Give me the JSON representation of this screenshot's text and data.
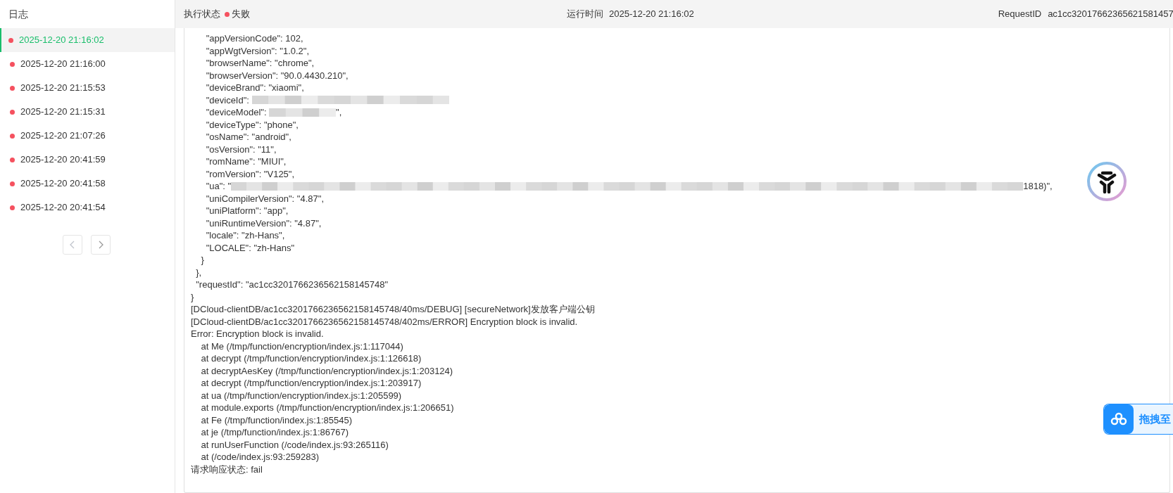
{
  "sidebar": {
    "title": "日志",
    "items": [
      {
        "time": "2025-12-20 21:16:02",
        "selected": true,
        "color": "#f5515f"
      },
      {
        "time": "2025-12-20 21:16:00",
        "selected": false,
        "color": "#f5515f"
      },
      {
        "time": "2025-12-20 21:15:53",
        "selected": false,
        "color": "#f5515f"
      },
      {
        "time": "2025-12-20 21:15:31",
        "selected": false,
        "color": "#f5515f"
      },
      {
        "time": "2025-12-20 21:07:26",
        "selected": false,
        "color": "#f5515f"
      },
      {
        "time": "2025-12-20 20:41:59",
        "selected": false,
        "color": "#f5515f"
      },
      {
        "time": "2025-12-20 20:41:58",
        "selected": false,
        "color": "#f5515f"
      },
      {
        "time": "2025-12-20 20:41:54",
        "selected": false,
        "color": "#f5515f"
      }
    ]
  },
  "header": {
    "status_label": "执行状态",
    "status": {
      "text": "失败",
      "color": "#f5515f"
    },
    "runtime_label": "运行时间",
    "runtime": "2025-12-20 21:16:02",
    "request_label": "RequestID",
    "request_id": "ac1cc32017662365621581457"
  },
  "log_lines": [
    {
      "kind": "text",
      "text": "      \"appVersionCode\": 102,"
    },
    {
      "kind": "text",
      "text": "      \"appWgtVersion\": \"1.0.2\","
    },
    {
      "kind": "text",
      "text": "      \"browserName\": \"chrome\","
    },
    {
      "kind": "text",
      "text": "      \"browserVersion\": \"90.0.4430.210\","
    },
    {
      "kind": "text",
      "text": "      \"deviceBrand\": \"xiaomi\","
    },
    {
      "kind": "redacted",
      "before": "      \"deviceId\": "
    },
    {
      "kind": "redacted",
      "before": "      \"deviceModel\": ",
      "after": "\","
    },
    {
      "kind": "text",
      "text": "      \"deviceType\": \"phone\","
    },
    {
      "kind": "text",
      "text": "      \"osName\": \"android\","
    },
    {
      "kind": "text",
      "text": "      \"osVersion\": \"11\","
    },
    {
      "kind": "text",
      "text": "      \"romName\": \"MIUI\","
    },
    {
      "kind": "text",
      "text": "      \"romVersion\": \"V125\","
    },
    {
      "kind": "redacted",
      "before": "      \"ua\": \"",
      "after": "1818)\","
    },
    {
      "kind": "text",
      "text": "      \"uniCompilerVersion\": \"4.87\","
    },
    {
      "kind": "text",
      "text": "      \"uniPlatform\": \"app\","
    },
    {
      "kind": "text",
      "text": "      \"uniRuntimeVersion\": \"4.87\","
    },
    {
      "kind": "text",
      "text": "      \"locale\": \"zh-Hans\","
    },
    {
      "kind": "text",
      "text": "      \"LOCALE\": \"zh-Hans\""
    },
    {
      "kind": "text",
      "text": "    }"
    },
    {
      "kind": "text",
      "text": "  },"
    },
    {
      "kind": "text",
      "text": "  \"requestId\": \"ac1cc3201766236562158145748\""
    },
    {
      "kind": "text",
      "text": "}"
    },
    {
      "kind": "text",
      "text": "[DCloud-clientDB/ac1cc3201766236562158145748/40ms/DEBUG] [secureNetwork]发放客户端公钥"
    },
    {
      "kind": "text",
      "text": "[DCloud-clientDB/ac1cc3201766236562158145748/402ms/ERROR] Encryption block is invalid."
    },
    {
      "kind": "text",
      "text": "Error: Encryption block is invalid."
    },
    {
      "kind": "text",
      "text": "    at Me (/tmp/function/encryption/index.js:1:117044)"
    },
    {
      "kind": "text",
      "text": "    at decrypt (/tmp/function/encryption/index.js:1:126618)"
    },
    {
      "kind": "text",
      "text": "    at decryptAesKey (/tmp/function/encryption/index.js:1:203124)"
    },
    {
      "kind": "text",
      "text": "    at decrypt (/tmp/function/encryption/index.js:1:203917)"
    },
    {
      "kind": "text",
      "text": "    at ua (/tmp/function/encryption/index.js:1:205599)"
    },
    {
      "kind": "text",
      "text": "    at module.exports (/tmp/function/encryption/index.js:1:206651)"
    },
    {
      "kind": "text",
      "text": "    at Fe (/tmp/function/index.js:1:85545)"
    },
    {
      "kind": "text",
      "text": "    at je (/tmp/function/index.js:1:86767)"
    },
    {
      "kind": "text",
      "text": "    at runUserFunction (/code/index.js:93:265116)"
    },
    {
      "kind": "text",
      "text": "    at (/code/index.js:93:259283)"
    },
    {
      "kind": "text",
      "text": "请求响应状态: fail"
    }
  ],
  "drag_tab": {
    "label": "拖拽至"
  }
}
